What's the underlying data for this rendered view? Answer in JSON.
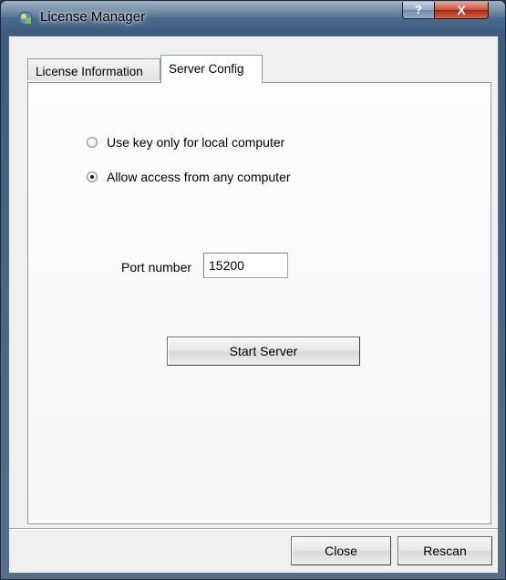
{
  "window": {
    "title": "License Manager",
    "help_label": "?",
    "close_label": "X"
  },
  "tabs": [
    {
      "label": "License Information",
      "active": false
    },
    {
      "label": "Server Config",
      "active": true
    }
  ],
  "server_config": {
    "radio_local": {
      "label": "Use key only for local computer",
      "checked": false
    },
    "radio_any": {
      "label": "Allow access from any computer",
      "checked": true
    },
    "port": {
      "label": "Port number",
      "value": "15200"
    },
    "start_button": "Start Server"
  },
  "footer": {
    "close_button": "Close",
    "rescan_button": "Rescan"
  },
  "icons": {
    "app": "license-manager-app-icon",
    "help": "help-icon",
    "close": "close-icon"
  },
  "colors": {
    "titlebar": "#4f6f8f",
    "close_button": "#c6513c",
    "client_bg": "#f0f0f0"
  }
}
